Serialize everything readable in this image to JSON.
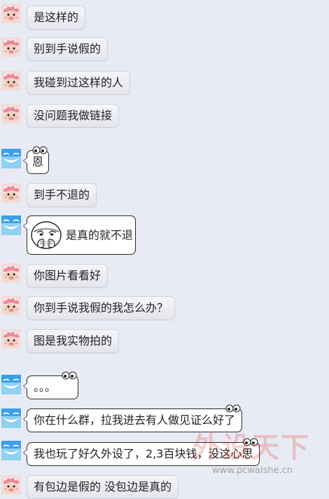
{
  "messages": [
    {
      "sender": "customer",
      "text": "是这样的"
    },
    {
      "sender": "customer",
      "text": "别到手说假的"
    },
    {
      "sender": "customer",
      "text": "我碰到过这样的人"
    },
    {
      "sender": "customer",
      "text": "没问题我做链接"
    },
    {
      "sender": "seller",
      "text": "恩"
    },
    {
      "sender": "customer",
      "text": "到手不退的"
    },
    {
      "sender": "seller",
      "text": "是真的就不退",
      "sticker": "covering-mouth-meme"
    },
    {
      "sender": "customer",
      "text": "你图片看看好"
    },
    {
      "sender": "customer",
      "text": "你到手说我假的我怎么办？"
    },
    {
      "sender": "customer",
      "text": "图是我实物拍的"
    },
    {
      "sender": "seller",
      "text": "。。。"
    },
    {
      "sender": "seller",
      "text": "你在什么群，拉我进去有人做见证么好了"
    },
    {
      "sender": "seller",
      "text": "我也玩了好久外设了，2,3百块钱，没这心思"
    },
    {
      "sender": "customer",
      "text": "有包边是假的 没包边是真的"
    }
  ],
  "watermark": {
    "title": "外设天下",
    "url": "www.pcwaishe.cn"
  },
  "colors": {
    "background": "#e9ebf4",
    "customer_bubble": "#eceef4",
    "seller_bubble": "#ffffff",
    "seller_avatar": "#2f9be6",
    "customer_avatar": "#f2c1b4"
  }
}
